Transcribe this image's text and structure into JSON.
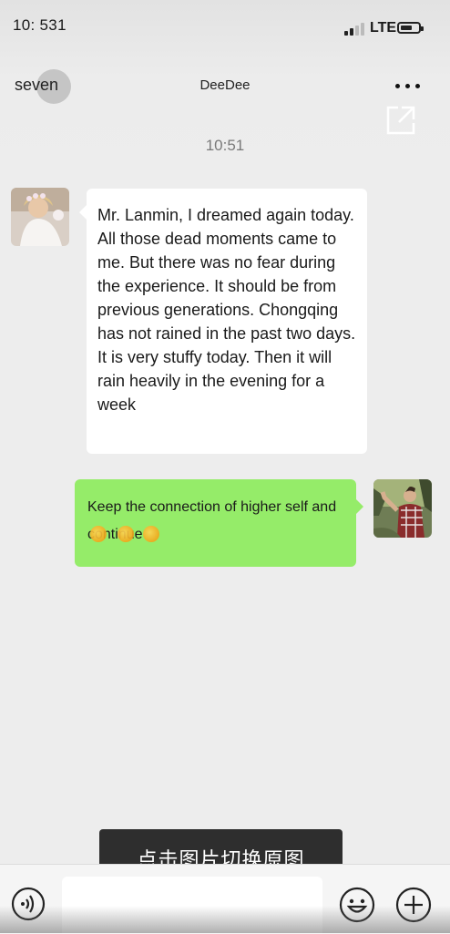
{
  "status_bar": {
    "time": "10: 531",
    "network": "LTE"
  },
  "header": {
    "back_label": "seven",
    "title": "DeeDee",
    "more_icon": "more-dots-icon",
    "share_icon": "share-external-icon"
  },
  "conversation": {
    "timestamp": "10:51",
    "messages": [
      {
        "direction": "incoming",
        "text": "Mr. Lanmin, I dreamed again today. All those dead moments came to me. But there was no fear during the experience. It should be from previous generations. Chongqing has not rained in the past two days. It is very stuffy today. Then it will rain heavily in the evening for a week"
      },
      {
        "direction": "outgoing",
        "text": "Keep the connection of higher self and continue",
        "emoji_count": 3
      }
    ]
  },
  "toast": {
    "text": "点击图片切换原图"
  },
  "input_bar": {
    "voice_icon": "voice-icon",
    "emoji_icon": "smiley-icon",
    "plus_icon": "plus-icon"
  },
  "colors": {
    "background": "#ededed",
    "outgoing_bubble": "#95ec69",
    "incoming_bubble": "#ffffff",
    "toast": "#2e2e2e"
  }
}
